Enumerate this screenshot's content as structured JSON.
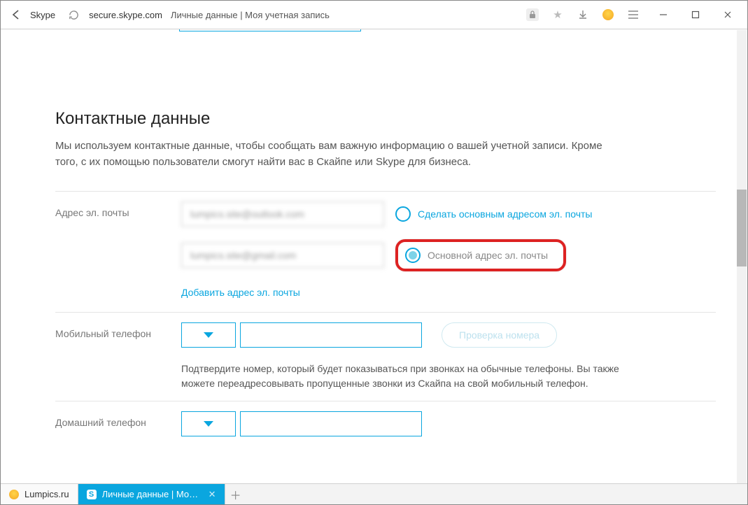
{
  "browser": {
    "site_name": "Skype",
    "url_domain": "secure.skype.com",
    "page_title": "Личные данные | Моя учетная запись"
  },
  "section": {
    "title": "Контактные данные",
    "description": "Мы используем контактные данные, чтобы сообщать вам важную информацию о вашей учетной записи. Кроме того, с их помощью пользователи смогут найти вас в Скайпе или Skype для бизнеса."
  },
  "email": {
    "label": "Адрес эл. почты",
    "value1": "lumpics.site@outlook.com",
    "value2": "lumpics.site@gmail.com",
    "make_primary": "Сделать основным адресом эл. почты",
    "primary_label": "Основной адрес эл. почты",
    "add_link": "Добавить адрес эл. почты"
  },
  "mobile": {
    "label": "Мобильный телефон",
    "verify_btn": "Проверка номера",
    "helper": "Подтвердите номер, который будет показываться при звонках на обычные телефоны. Вы также можете переадресовывать пропущенные звонки из Скайпа на свой мобильный телефон."
  },
  "home_phone": {
    "label": "Домашний телефон"
  },
  "tabs": {
    "tab1": "Lumpics.ru",
    "tab2": "Личные данные | Моя уч",
    "skype_initial": "S"
  }
}
